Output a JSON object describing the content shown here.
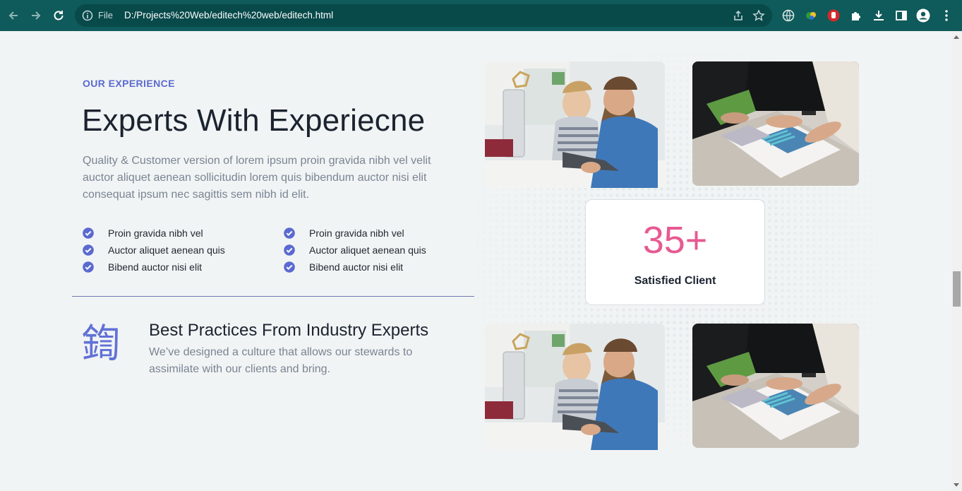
{
  "browser": {
    "scheme_label": "File",
    "url": "D:/Projects%20Web/editech%20web/editech.html"
  },
  "section": {
    "eyebrow": "OUR EXPERIENCE",
    "title": "Experts With Experiecne",
    "description": "Quality & Customer version of lorem ipsum proin gravida nibh vel velit auctor aliquet aenean sollicitudin lorem quis bibendum auctor nisi elit consequat ipsum nec sagittis sem nibh id elit.",
    "list_left": [
      "Proin gravida nibh vel",
      "Auctor aliquet aenean quis",
      "Bibend auctor nisi elit"
    ],
    "list_right": [
      "Proin gravida nibh vel",
      "Auctor aliquet aenean quis",
      "Bibend auctor nisi elit"
    ]
  },
  "feature": {
    "icon_glyph": "鍧",
    "title": "Best Practices From Industry Experts",
    "text": "We’ve designed a culture that allows our stewards to assimilate with our clients and bring."
  },
  "stat": {
    "number": "35+",
    "label": "Satisfied Client"
  },
  "colors": {
    "accent": "#5b6ad0",
    "stat": "#e65a91",
    "chrome": "#0f5a5a"
  }
}
